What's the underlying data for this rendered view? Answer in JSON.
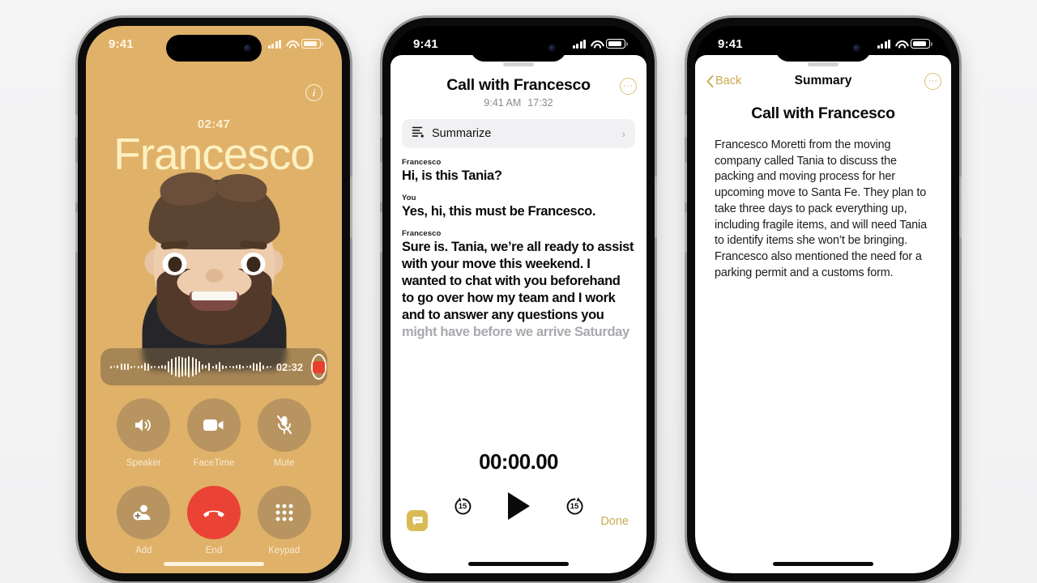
{
  "background_color": "#f3f3f4",
  "phone1": {
    "name": "in-call-screen",
    "accent_color": "#e0b169",
    "status": {
      "time": "9:41"
    },
    "call_timer": "02:47",
    "caller_name": "Francesco",
    "info_glyph": "i",
    "recorder": {
      "elapsed": "02:32",
      "record_label": "record"
    },
    "controls": [
      {
        "label": "Speaker",
        "icon": "speaker-icon"
      },
      {
        "label": "FaceTime",
        "icon": "video-camera-icon"
      },
      {
        "label": "Mute",
        "icon": "mic-muted-icon"
      },
      {
        "label": "Add",
        "icon": "add-person-icon"
      },
      {
        "label": "End",
        "icon": "end-call-icon"
      },
      {
        "label": "Keypad",
        "icon": "keypad-icon"
      }
    ]
  },
  "phone2": {
    "name": "call-recording-transcript",
    "status": {
      "time": "9:41"
    },
    "title": "Call with Francesco",
    "subtitle_time": "9:41 AM",
    "subtitle_duration": "17:32",
    "more_glyph": "···",
    "summarize_label": "Summarize",
    "chevron": "›",
    "transcript": [
      {
        "speaker": "Francesco",
        "text": "Hi, is this Tania?",
        "faded": ""
      },
      {
        "speaker": "You",
        "text": "Yes, hi, this must be Francesco.",
        "faded": ""
      },
      {
        "speaker": "Francesco",
        "text": "Sure is. Tania, we’re all ready to assist with your move this weekend. I wanted to chat with you beforehand to go over how my team and I work and to answer any questions you ",
        "faded": "might have before we arrive Saturday"
      }
    ],
    "player": {
      "time": "00:00.00",
      "skip_back": "15",
      "skip_forward": "15",
      "play": "play"
    },
    "done_label": "Done",
    "bubble_icon": "transcript-bubble-icon"
  },
  "phone3": {
    "name": "call-summary-screen",
    "status": {
      "time": "9:41"
    },
    "back_label": "Back",
    "nav_title": "Summary",
    "more_glyph": "···",
    "heading": "Call with Francesco",
    "body": "Francesco Moretti from the moving company called Tania to discuss the packing and moving process for her upcoming move to Santa Fe. They plan to take three days to pack everything up, including fragile items, and will need Tania to identify items she won’t be bringing. Francesco also mentioned the need for a parking permit and a customs form."
  }
}
